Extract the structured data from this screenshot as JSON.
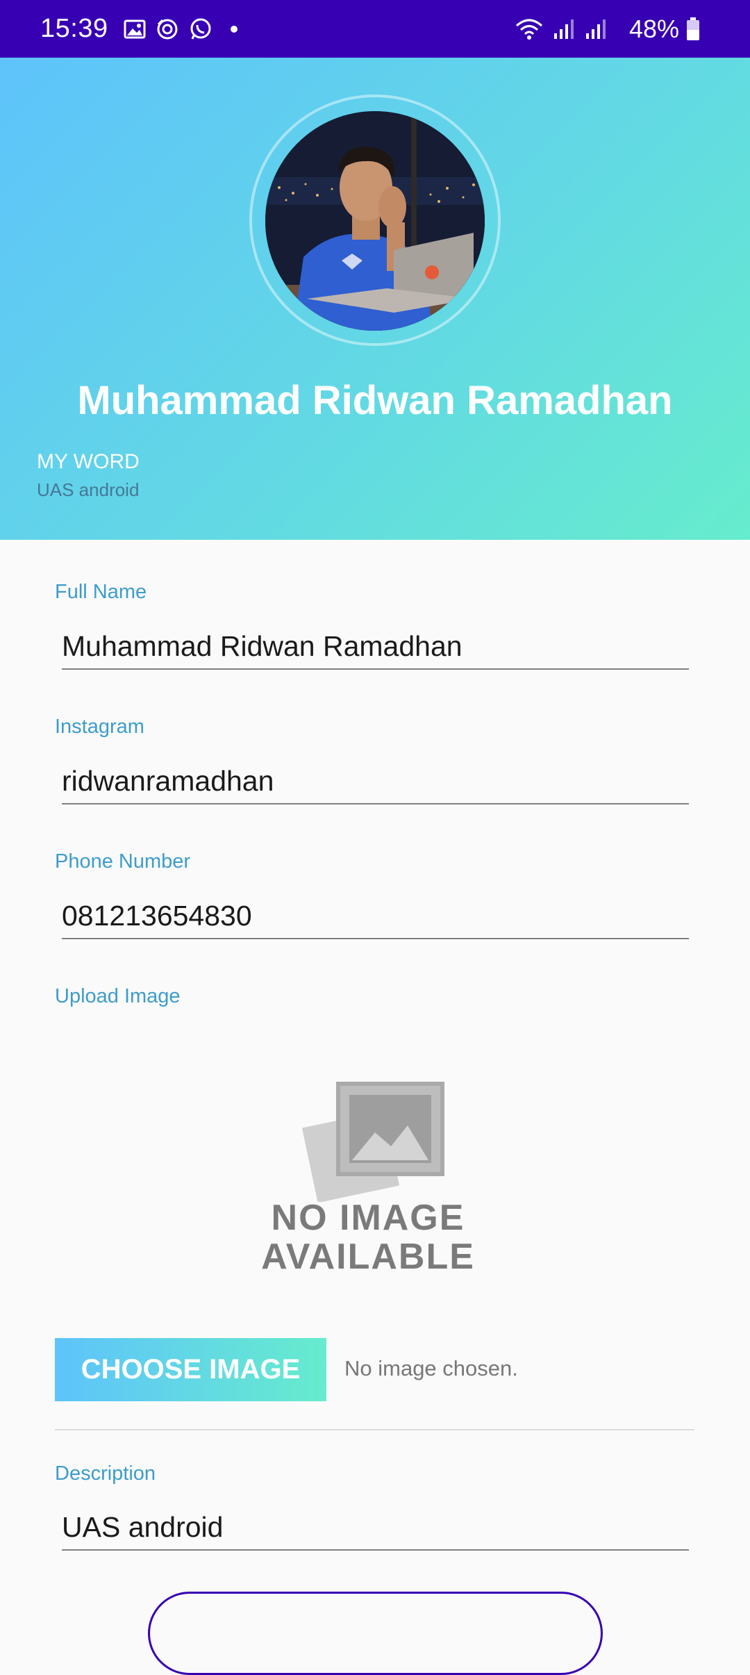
{
  "status_bar": {
    "time": "15:39",
    "battery": "48%",
    "icons": [
      "gallery-icon",
      "sync-icon",
      "whatsapp-icon",
      "dot-icon",
      "wifi-icon",
      "signal-icon",
      "signal-icon",
      "battery-icon"
    ],
    "background_color": "#3700b3"
  },
  "header": {
    "profile_name": "Muhammad Ridwan Ramadhan",
    "word_title": "MY WORD",
    "word_subtitle": "UAS android",
    "gradient_colors": [
      "#5ec3fb",
      "#66eccd"
    ]
  },
  "form": {
    "full_name_label": "Full Name",
    "full_name_value": "Muhammad Ridwan Ramadhan",
    "instagram_label": "Instagram",
    "instagram_value": "ridwanramadhan",
    "phone_label": "Phone Number",
    "phone_value": "081213654830",
    "upload_label": "Upload Image",
    "no_image_line1": "NO IMAGE",
    "no_image_line2": "AVAILABLE",
    "choose_button": "CHOOSE IMAGE",
    "chosen_status": "No image chosen.",
    "description_label": "Description",
    "description_value": "UAS android",
    "label_color": "#3d9ccc"
  }
}
